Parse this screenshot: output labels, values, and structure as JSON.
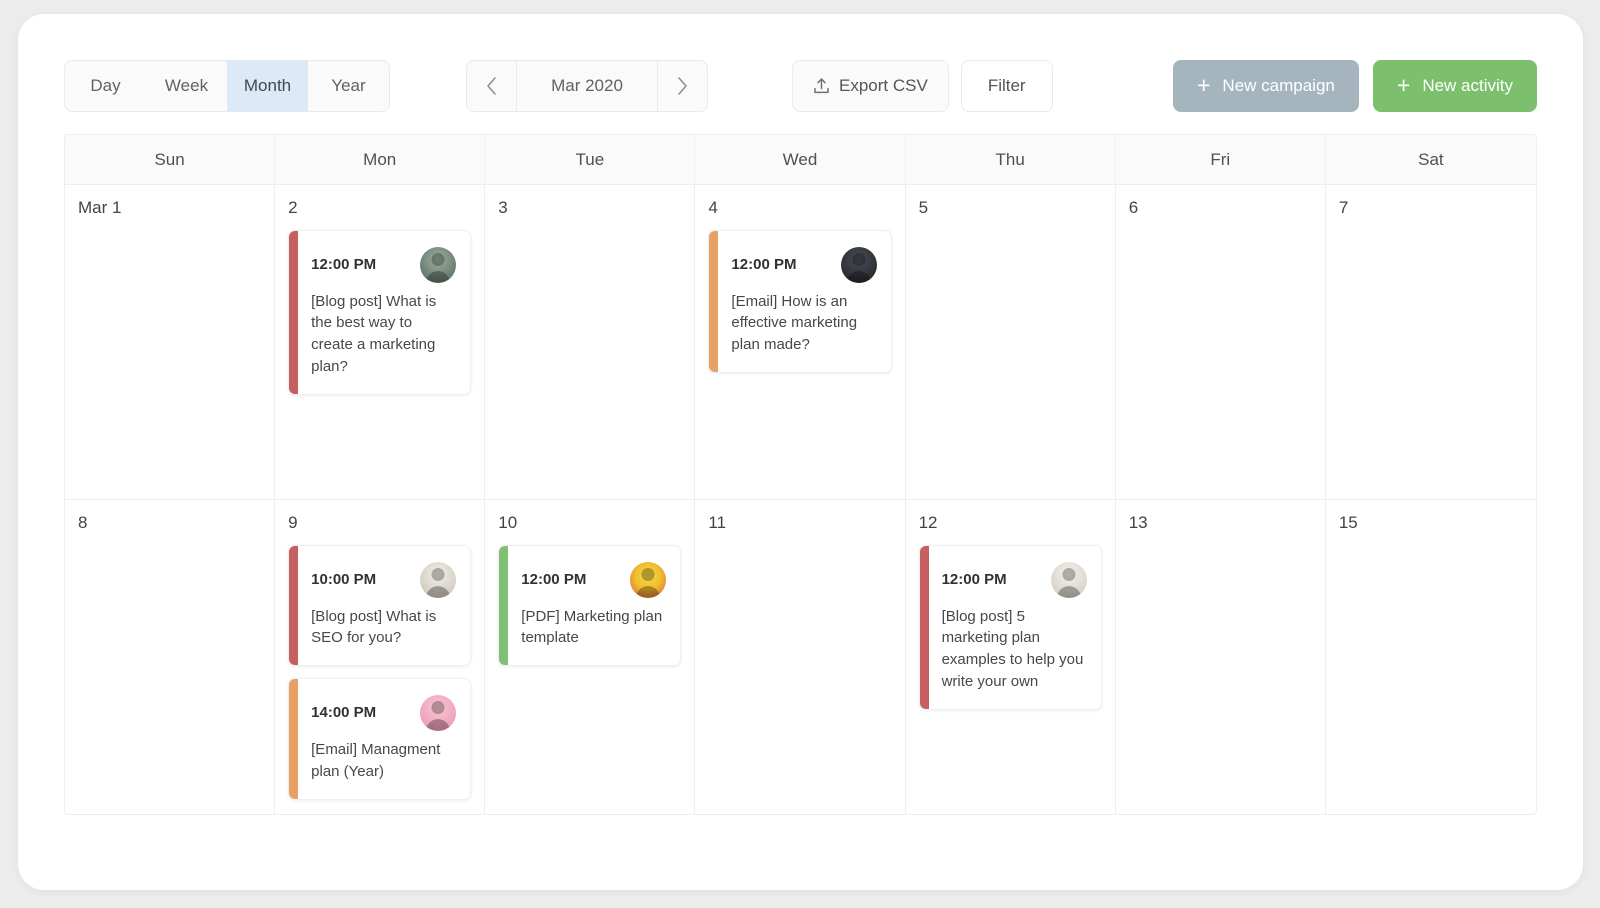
{
  "toolbar": {
    "range_options": [
      {
        "label": "Day",
        "active": false
      },
      {
        "label": "Week",
        "active": false
      },
      {
        "label": "Month",
        "active": true
      },
      {
        "label": "Year",
        "active": false
      }
    ],
    "prev_label": "‹",
    "next_label": "›",
    "month_label": "Mar 2020",
    "export_label": "Export CSV",
    "export_icon": "upload-icon",
    "filter_label": "Filter",
    "new_campaign_label": "New campaign",
    "new_activity_label": "New activity",
    "plus_glyph": "+"
  },
  "colors": {
    "page_background": "#ececec",
    "card_background": "#ffffff",
    "active_segment": "#dceaf8",
    "new_campaign": "#a5b5bd",
    "new_activity": "#7cc06d",
    "accent_blog_post": "#c65f5f",
    "accent_email": "#e7a165",
    "accent_pdf": "#7fc072",
    "grid_line": "#eceef0",
    "header_background": "#fafafb"
  },
  "calendar": {
    "weekdays": [
      "Sun",
      "Mon",
      "Tue",
      "Wed",
      "Thu",
      "Fri",
      "Sat"
    ],
    "weeks": [
      {
        "days": [
          {
            "number": "Mar 1",
            "events": []
          },
          {
            "number": "2",
            "events": [
              {
                "time": "12:00 PM",
                "title": "[Blog post] What is the best way to create a marketing plan?",
                "type": "blog-post",
                "accent": "#c65f5f",
                "avatar": "av-a"
              }
            ]
          },
          {
            "number": "3",
            "events": []
          },
          {
            "number": "4",
            "events": [
              {
                "time": "12:00 PM",
                "title": "[Email] How is an effective marketing plan made?",
                "type": "email",
                "accent": "#e7a165",
                "avatar": "av-b"
              }
            ]
          },
          {
            "number": "5",
            "events": []
          },
          {
            "number": "6",
            "events": []
          },
          {
            "number": "7",
            "events": []
          }
        ]
      },
      {
        "days": [
          {
            "number": "8",
            "events": []
          },
          {
            "number": "9",
            "events": [
              {
                "time": "10:00 PM",
                "title": "[Blog post] What is SEO for you?",
                "type": "blog-post",
                "accent": "#c65f5f",
                "avatar": "av-c"
              },
              {
                "time": "14:00 PM",
                "title": "[Email] Managment plan (Year)",
                "type": "email",
                "accent": "#e7a165",
                "avatar": "av-d"
              }
            ]
          },
          {
            "number": "10",
            "events": [
              {
                "time": "12:00 PM",
                "title": "[PDF] Marketing plan template",
                "type": "pdf",
                "accent": "#7fc072",
                "avatar": "av-e"
              }
            ]
          },
          {
            "number": "11",
            "events": []
          },
          {
            "number": "12",
            "events": [
              {
                "time": "12:00 PM",
                "title": "[Blog post] 5 marketing plan examples to help you write your own",
                "type": "blog-post",
                "accent": "#c65f5f",
                "avatar": "av-f"
              }
            ]
          },
          {
            "number": "13",
            "events": []
          },
          {
            "number": "15",
            "events": []
          }
        ]
      }
    ]
  }
}
